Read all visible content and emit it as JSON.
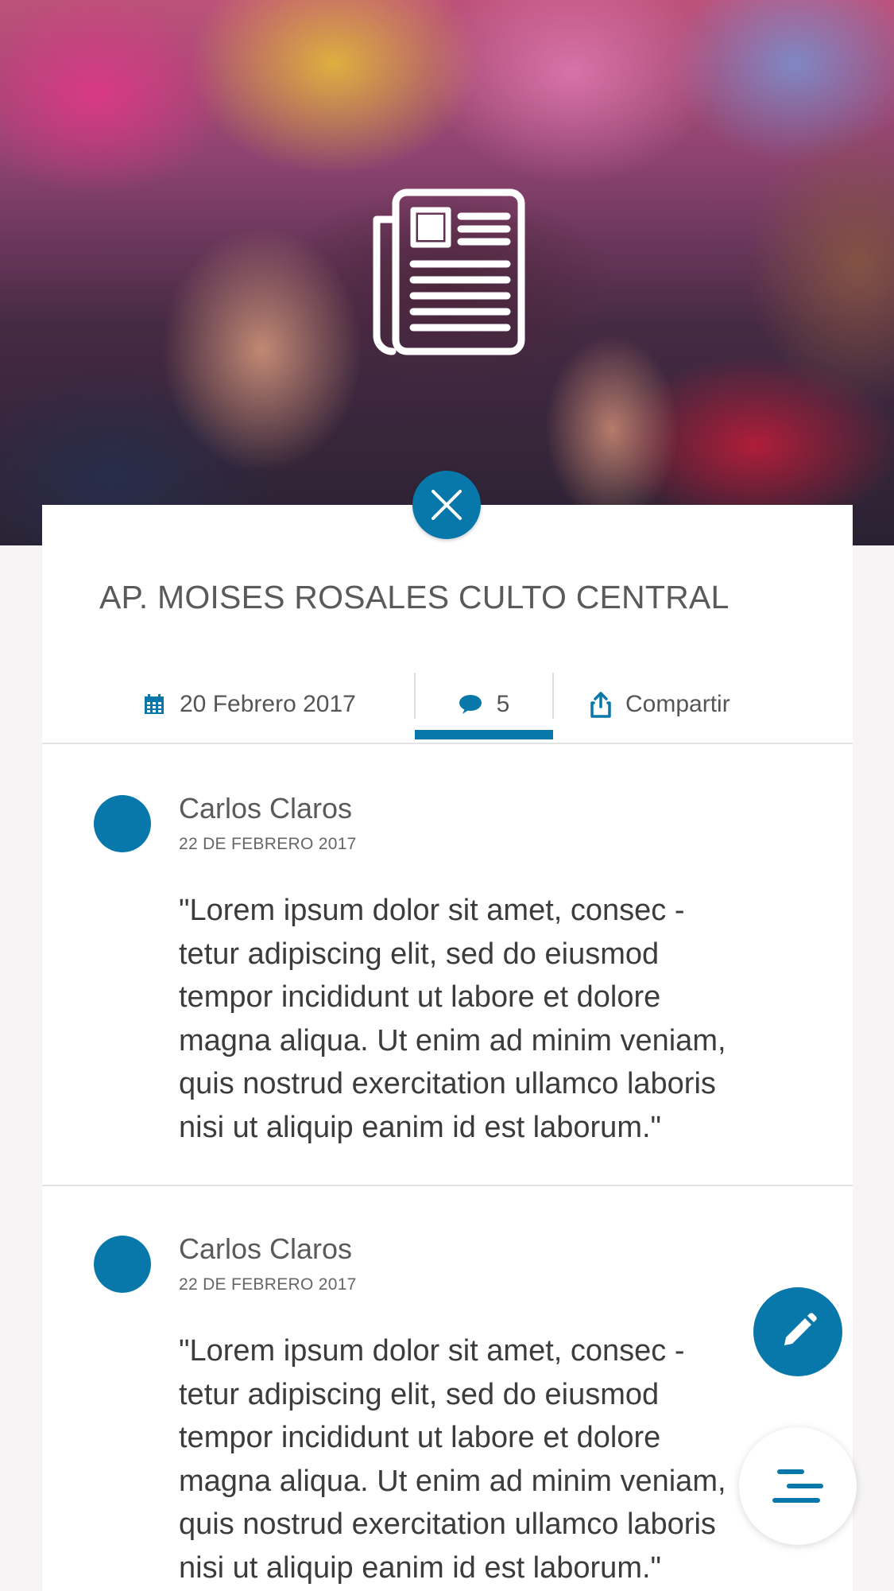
{
  "hero": {
    "icon": "newspaper-icon"
  },
  "close": {
    "icon": "close-icon"
  },
  "article": {
    "title": "AP. MOISES ROSALES CULTO CENTRAL"
  },
  "meta": {
    "date": "20 Febrero 2017",
    "date_icon": "calendar-icon",
    "comments_count": "5",
    "comments_icon": "comment-bubble-icon",
    "share_label": "Compartir",
    "share_icon": "share-icon",
    "active_tab": "comments"
  },
  "comments": [
    {
      "author": "Carlos Claros",
      "date": "22 DE FEBRERO 2017",
      "body_lines": [
        "\"Lorem ipsum dolor sit amet, consec      -",
        "tetur adipiscing elit, sed do eiusmod",
        "tempor incididunt ut labore et dolore",
        "magna aliqua. Ut enim ad minim veniam,",
        "quis nostrud exercitation ullamco laboris",
        "nisi ut aliquip eanim id est laborum.\""
      ]
    },
    {
      "author": "Carlos Claros",
      "date": "22 DE FEBRERO 2017",
      "body_lines": [
        "\"Lorem ipsum dolor sit amet, consec      -",
        "tetur adipiscing elit, sed do eiusmod",
        "tempor incididunt ut labore et dolore",
        "magna aliqua. Ut enim ad minim veniam,",
        "quis nostrud exercitation ullamco laboris",
        "nisi ut aliquip eanim id est laborum.\""
      ]
    }
  ],
  "fab": {
    "edit_icon": "pencil-icon",
    "menu_icon": "menu-icon"
  },
  "colors": {
    "accent": "#0878aa",
    "card": "#ffffff",
    "background": "#f6f4f4",
    "text": "#3c3c3c"
  }
}
